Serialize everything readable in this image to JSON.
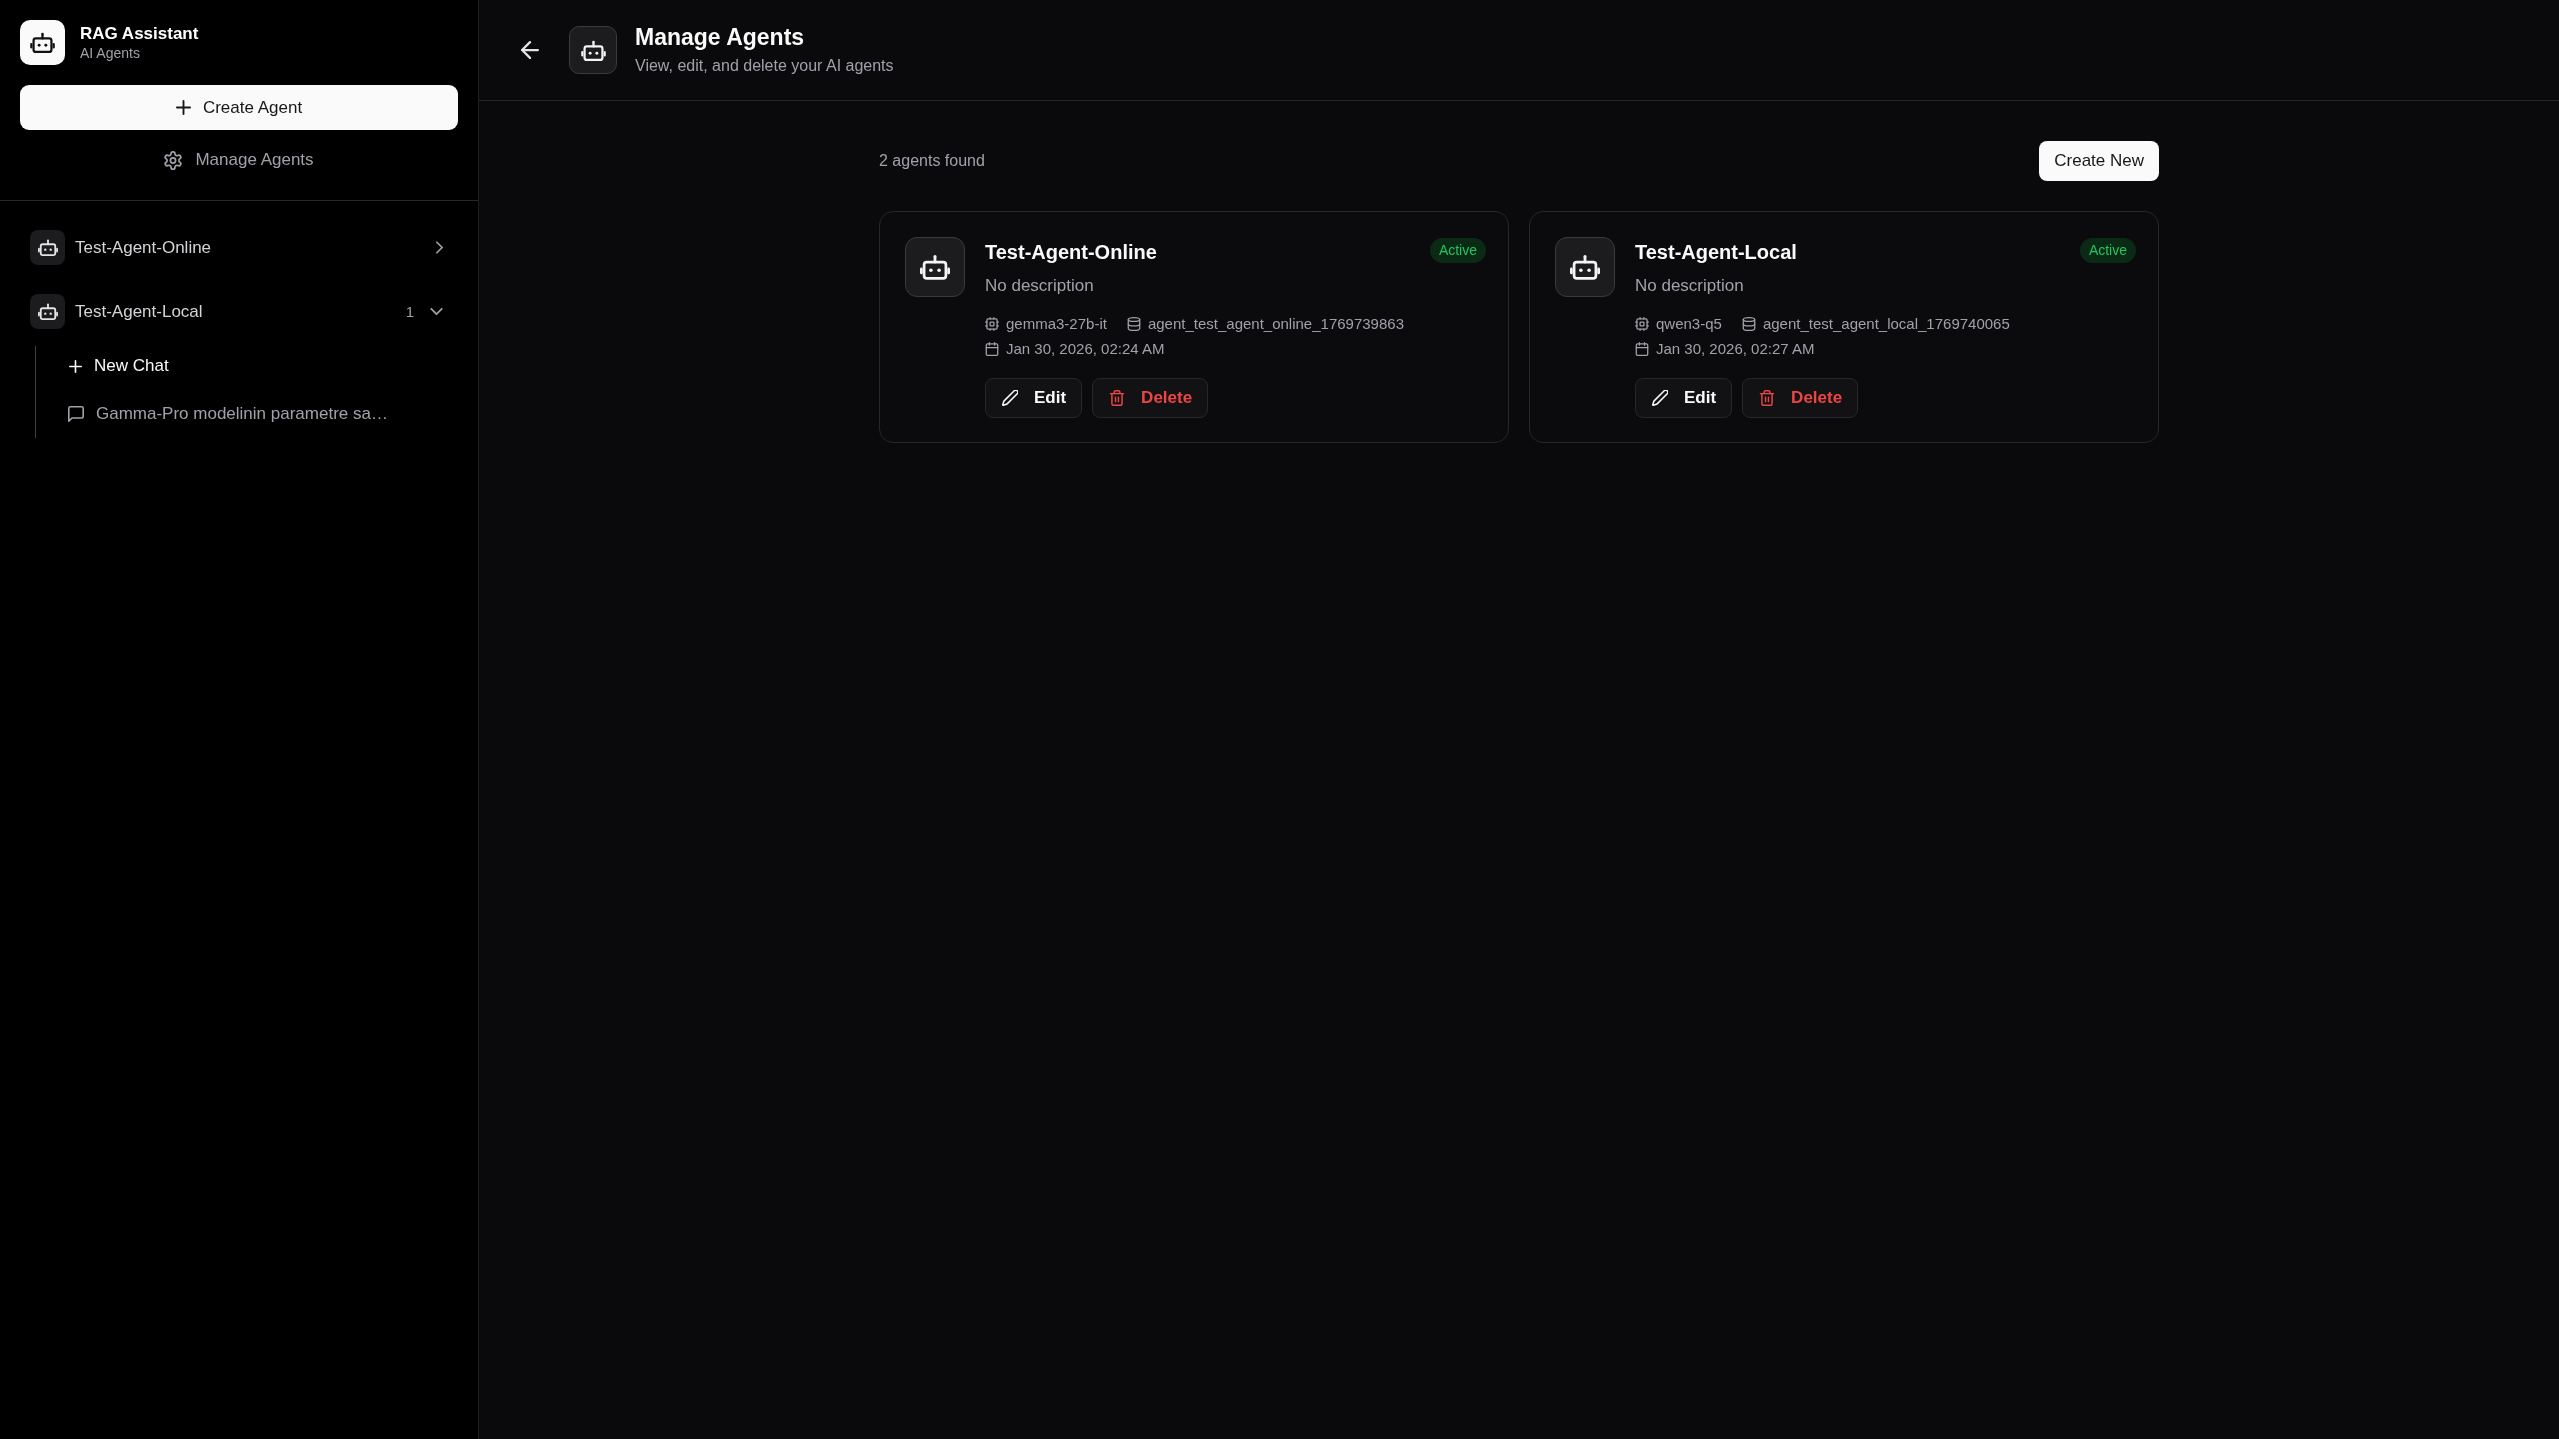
{
  "sidebar": {
    "brand": {
      "title": "RAG Assistant",
      "subtitle": "AI Agents"
    },
    "create_button": "Create Agent",
    "manage_button": "Manage Agents",
    "agents": [
      {
        "name": "Test-Agent-Online",
        "expanded": false
      },
      {
        "name": "Test-Agent-Local",
        "count": "1",
        "expanded": true,
        "children": [
          {
            "kind": "new",
            "label": "New Chat"
          },
          {
            "kind": "chat",
            "label": "Gamma-Pro modelinin parametre sa…"
          }
        ]
      }
    ]
  },
  "header": {
    "title": "Manage Agents",
    "subtitle": "View, edit, and delete your AI agents"
  },
  "summary": "2 agents found",
  "create_new_button": "Create New",
  "agents": [
    {
      "name": "Test-Agent-Online",
      "status": "Active",
      "description": "No description",
      "model": "gemma3-27b-it",
      "collection": "agent_test_agent_online_1769739863",
      "created": "Jan 30, 2026, 02:24 AM",
      "actions": [
        {
          "kind": "edit",
          "label": "Edit"
        },
        {
          "kind": "delete",
          "label": "Delete"
        }
      ]
    },
    {
      "name": "Test-Agent-Local",
      "status": "Active",
      "description": "No description",
      "model": "qwen3-q5",
      "collection": "agent_test_agent_local_1769740065",
      "created": "Jan 30, 2026, 02:27 AM",
      "actions": [
        {
          "kind": "edit",
          "label": "Edit"
        },
        {
          "kind": "delete",
          "label": "Delete"
        }
      ]
    }
  ]
}
